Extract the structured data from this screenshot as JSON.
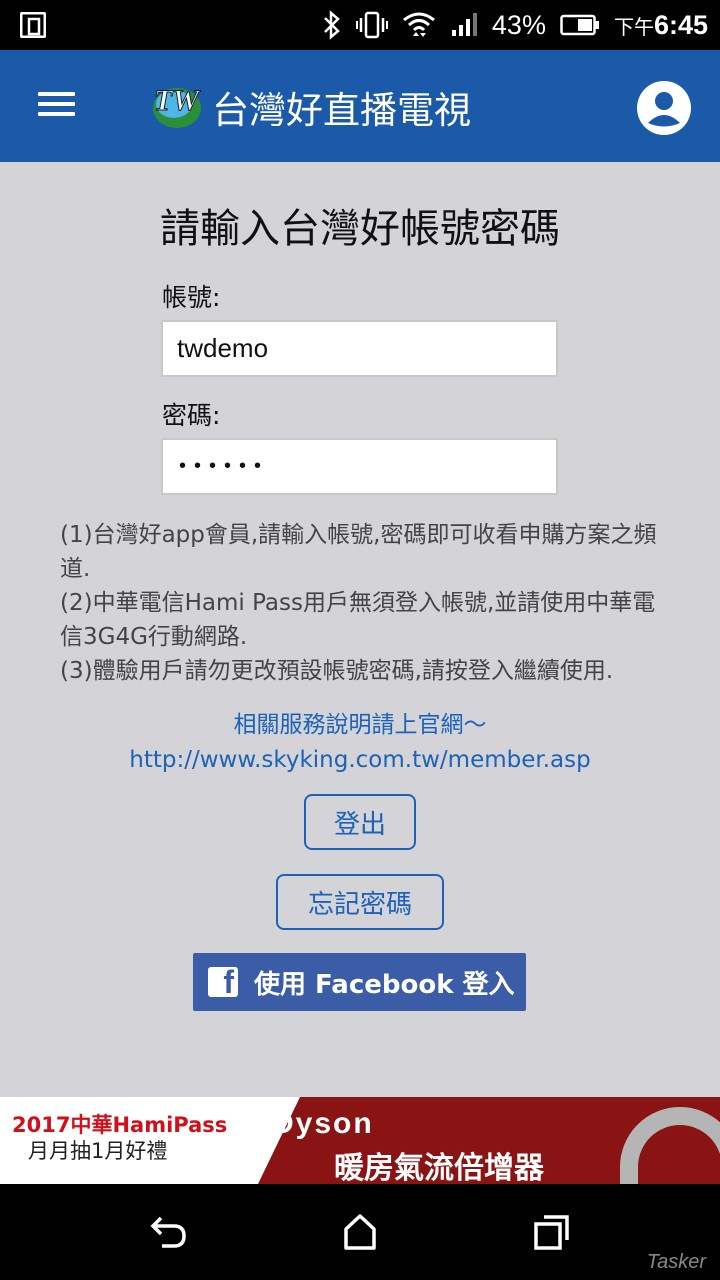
{
  "status_bar": {
    "battery_percent": "43%",
    "time_prefix": "下午",
    "time": "6:45"
  },
  "app_bar": {
    "logo_text": "TW",
    "title": "台灣好直播電視"
  },
  "login": {
    "heading": "請輸入台灣好帳號密碼",
    "account_label": "帳號:",
    "account_value": "twdemo",
    "password_label": "密碼:",
    "password_value": "••••••"
  },
  "notes": [
    "(1)台灣好app會員,請輸入帳號,密碼即可收看申購方案之頻道.",
    "(2)中華電信Hami Pass用戶無須登入帳號,並請使用中華電信3G4G行動網路.",
    "(3)體驗用戶請勿更改預設帳號密碼,請按登入繼續使用."
  ],
  "service_link": {
    "text": "相關服務說明請上官網～",
    "url": "http://www.skyking.com.tw/member.asp"
  },
  "buttons": {
    "logout": "登出",
    "forgot_password": "忘記密碼",
    "facebook_login": "使用 Facebook 登入"
  },
  "ad": {
    "line1": "2017中華HamiPass",
    "line2": "月月抽1月好禮",
    "brand": "Dyson",
    "product": "暖房氣流倍增器"
  },
  "watermark": "Tasker",
  "colors": {
    "app_bar": "#1a5aa8",
    "link": "#1b62b8",
    "facebook": "#3b5ca6",
    "background": "#d4d4d8"
  }
}
